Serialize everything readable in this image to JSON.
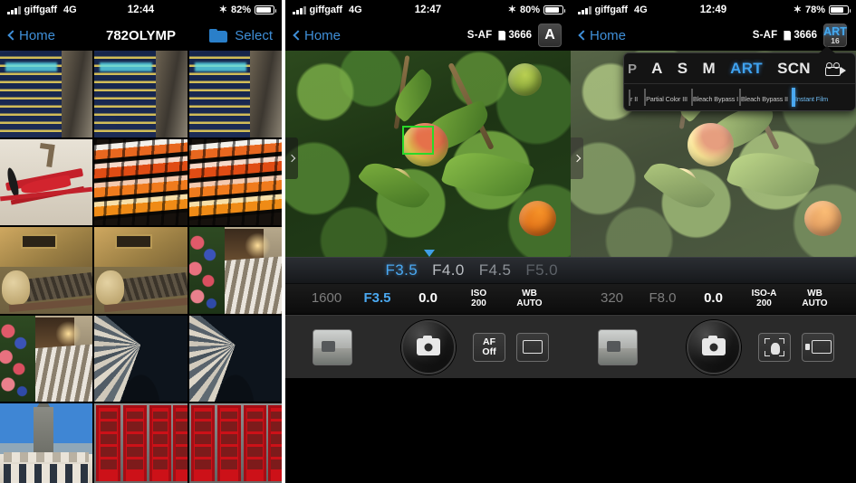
{
  "panel1": {
    "status": {
      "carrier": "giffgaff",
      "network": "4G",
      "time": "12:44",
      "battery": "82%",
      "bluetooth": "✶"
    },
    "nav": {
      "back_label": "Home",
      "title": "782OLYMP",
      "select_label": "Select",
      "folder_icon": "folder-icon"
    },
    "grid": [
      {
        "name": "chalkboard-sign-1",
        "art": "art-sign"
      },
      {
        "name": "chalkboard-sign-2",
        "art": "art-sign"
      },
      {
        "name": "chalkboard-sign-3",
        "art": "art-sign"
      },
      {
        "name": "red-biplane",
        "art": "art-plane"
      },
      {
        "name": "produce-shelves-1",
        "art": "art-shelf"
      },
      {
        "name": "produce-shelves-2",
        "art": "art-shelf"
      },
      {
        "name": "stone-effigy-1",
        "art": "art-tomb"
      },
      {
        "name": "stone-effigy-2",
        "art": "art-tomb"
      },
      {
        "name": "church-flowers-1",
        "art": "art-church"
      },
      {
        "name": "church-flowers-2",
        "art": "art-church"
      },
      {
        "name": "cathedral-vault-1",
        "art": "art-vault"
      },
      {
        "name": "cathedral-vault-2",
        "art": "art-vault"
      },
      {
        "name": "church-spire",
        "art": "art-spire"
      },
      {
        "name": "red-phone-boxes-1",
        "art": "art-phone"
      },
      {
        "name": "red-phone-boxes-2",
        "art": "art-phone"
      }
    ]
  },
  "panel2": {
    "status": {
      "carrier": "giffgaff",
      "network": "4G",
      "time": "12:47",
      "battery": "80%",
      "bluetooth": "✶"
    },
    "nav": {
      "back_label": "Home",
      "af_mode": "S-AF",
      "shots_remaining": "3666",
      "mode_badge": "A"
    },
    "aperture": {
      "options": [
        {
          "label": "F3.5",
          "selected": true
        },
        {
          "label": "F4.0",
          "selected": false
        },
        {
          "label": "F4.5",
          "selected": false
        },
        {
          "label": "F5.0",
          "selected": false
        }
      ]
    },
    "settings": [
      {
        "name": "shutter-speed",
        "value": "1600",
        "state": "dim"
      },
      {
        "name": "aperture",
        "value": "F3.5",
        "state": "blue"
      },
      {
        "name": "exposure-compensation",
        "value": "0.0",
        "state": "white"
      },
      {
        "name": "iso",
        "line1": "ISO",
        "line2": "200"
      },
      {
        "name": "white-balance",
        "line1": "WB",
        "line2": "AUTO"
      }
    ],
    "bottom": {
      "thumbnail": "last-photo-thumbnail",
      "shutter": "shutter-button",
      "af_line1": "AF",
      "af_line2": "Off",
      "frame_icon": "aspect-ratio-icon"
    }
  },
  "panel3": {
    "status": {
      "carrier": "giffgaff",
      "network": "4G",
      "time": "12:49",
      "battery": "78%",
      "bluetooth": "✶"
    },
    "nav": {
      "back_label": "Home",
      "af_mode": "S-AF",
      "shots_remaining": "3666",
      "mode_badge_main": "ART",
      "mode_badge_sub": "16"
    },
    "art_popup": {
      "modes": [
        {
          "label": "P",
          "active": false,
          "cut": true
        },
        {
          "label": "A",
          "active": false
        },
        {
          "label": "S",
          "active": false
        },
        {
          "label": "M",
          "active": false
        },
        {
          "label": "ART",
          "active": true
        },
        {
          "label": "SCN",
          "active": false
        }
      ],
      "video_icon": "video-camera-icon",
      "filters": [
        {
          "label": "r II",
          "art": "ft-green",
          "selected": false,
          "partial": true
        },
        {
          "label": "Partial Color III",
          "art": "ft-portrait",
          "selected": false
        },
        {
          "label": "Bleach Bypass I",
          "art": "ft-plane",
          "selected": false
        },
        {
          "label": "Bleach Bypass II",
          "art": "ft-plane",
          "selected": false
        },
        {
          "label": "Instant Film",
          "art": "ft-instant",
          "selected": true
        }
      ]
    },
    "settings": [
      {
        "name": "shutter-speed",
        "value": "320",
        "state": "dim"
      },
      {
        "name": "aperture",
        "value": "F8.0",
        "state": "dim"
      },
      {
        "name": "exposure-compensation",
        "value": "0.0",
        "state": "white"
      },
      {
        "name": "iso",
        "line1": "ISO-A",
        "line2": "200"
      },
      {
        "name": "white-balance",
        "line1": "WB",
        "line2": "AUTO"
      }
    ],
    "bottom": {
      "thumbnail": "last-photo-thumbnail",
      "shutter": "shutter-button",
      "touch_af_icon": "touch-af-icon",
      "frame_icon": "aspect-ratio-icon"
    }
  },
  "colors": {
    "accent_blue": "#4aa8f0",
    "link_blue": "#3f8fd8",
    "af_green": "#2ad92a"
  }
}
